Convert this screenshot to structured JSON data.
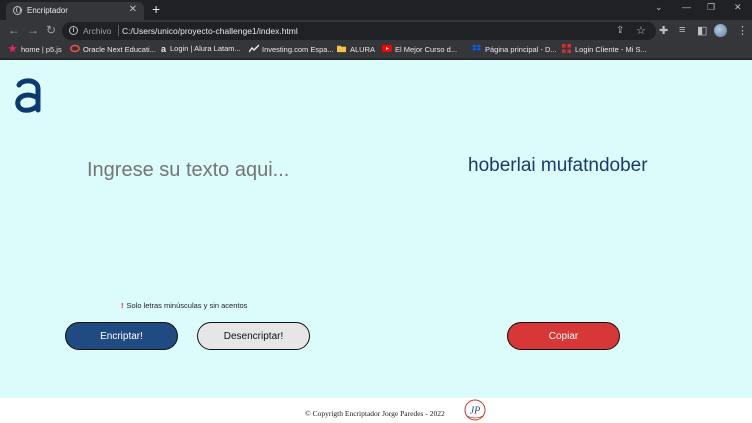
{
  "browser": {
    "tab_title": "Encriptador",
    "tab_close": "✕",
    "new_tab": "+",
    "window_controls": {
      "minimize": "—",
      "restore": "❐",
      "close": "✕",
      "chevron": "⌄"
    },
    "address_prefix": "Archivo",
    "url": "C:/Users/unico/proyecto-challenge1/index.html",
    "bookmarks": [
      {
        "label": "home | p5.js",
        "icon": "p5-star-icon",
        "color": "#ed225d"
      },
      {
        "label": "Oracle Next Educati...",
        "icon": "oracle-icon",
        "color": "#f0504a"
      },
      {
        "label": "Login | Alura Latam...",
        "icon": "alura-icon",
        "color": "#e8eaed"
      },
      {
        "label": "Investing.com Espa...",
        "icon": "investing-icon",
        "color": "#e8eaed"
      },
      {
        "label": "ALURA",
        "icon": "folder-icon",
        "color": "#f4c542"
      },
      {
        "label": "El Mejor Curso d...",
        "icon": "youtube-icon",
        "color": "#ff0000"
      },
      {
        "label": "Página principal - D...",
        "icon": "dropbox-icon",
        "color": "#0061fe"
      },
      {
        "label": "Login Cliente - Mi S...",
        "icon": "client-icon",
        "color": "#d32f2f"
      }
    ]
  },
  "app": {
    "logo_icon": "alura-logo-icon",
    "input_placeholder": "Ingrese su texto aqui...",
    "result": "hoberlai mufatndober",
    "warning": "Solo letras minúsculas y sin acentos",
    "warning_icon": "!",
    "encrypt_label": "Encriptar!",
    "decrypt_label": "Desencriptar!",
    "copy_label": "Copiar",
    "colors": {
      "background": "#dcfcfc",
      "encrypt": "#204a82",
      "decrypt": "#e6e6e6",
      "copy": "#d73737",
      "text": "#1a3a6e"
    }
  },
  "footer": {
    "text": "© Copyrigth Encriptador Jorge Paredes - 2022",
    "logo_text": "JP"
  }
}
